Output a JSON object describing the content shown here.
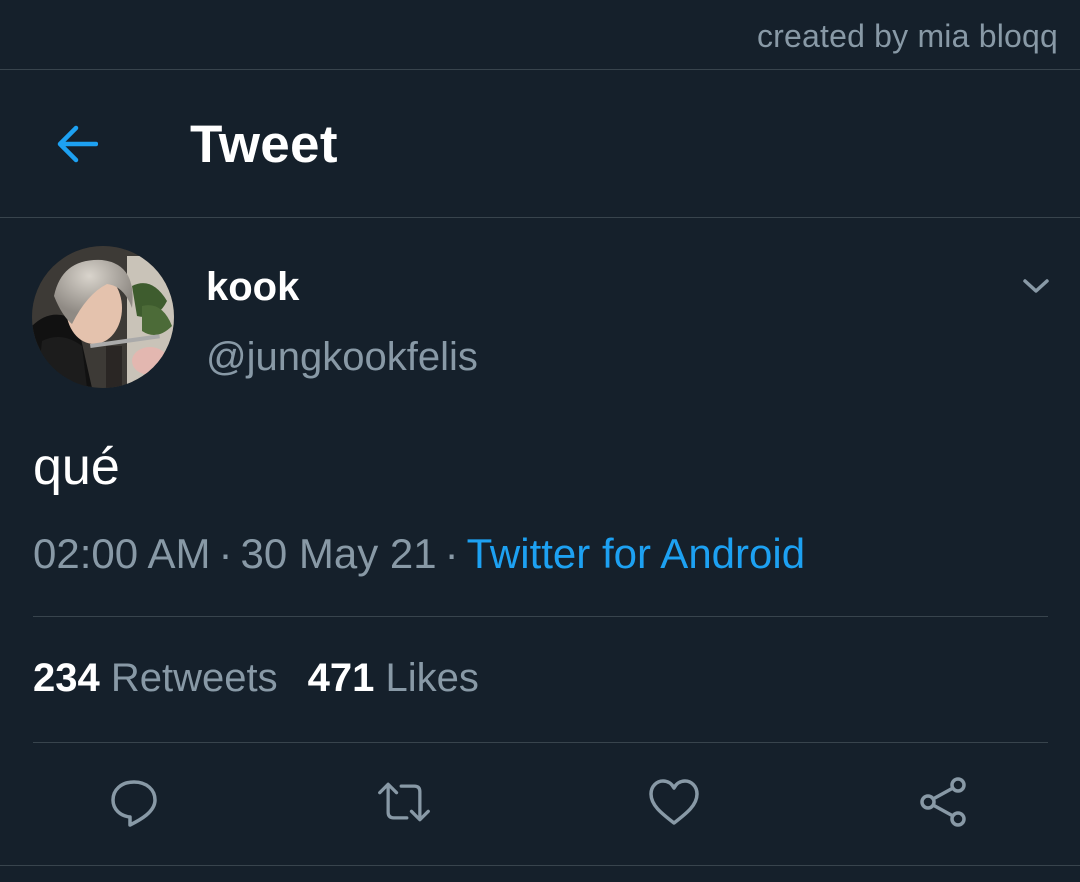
{
  "watermark": "created by mia bloqq",
  "header": {
    "title": "Tweet",
    "back_icon": "arrow-left-icon"
  },
  "tweet": {
    "author": {
      "name": "kook",
      "handle": "@jungkookfelis"
    },
    "text": "qué",
    "time": "02:00 AM",
    "date": "30 May 21",
    "separator": "·",
    "source": "Twitter for Android",
    "stats": {
      "retweets_count": "234",
      "retweets_label": "Retweets",
      "likes_count": "471",
      "likes_label": "Likes"
    }
  },
  "actions": [
    "reply-icon",
    "retweet-icon",
    "like-icon",
    "share-icon"
  ],
  "colors": {
    "background": "#15202b",
    "accent": "#1da1f2",
    "secondary_text": "#8899a6",
    "divider": "#38444d"
  }
}
